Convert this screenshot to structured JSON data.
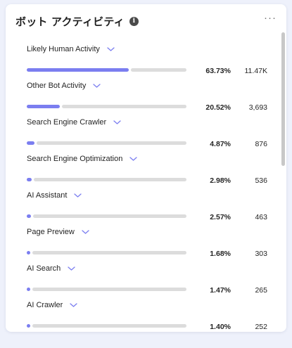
{
  "widget": {
    "title": "ボット アクティビティ",
    "info_icon_glyph": "i",
    "more_icon_glyph": "···",
    "accent_color": "#7b7ef0",
    "track_color": "#dcdcdc"
  },
  "chart_data": {
    "type": "bar",
    "orientation": "horizontal",
    "categories": [
      "Likely Human Activity",
      "Other Bot Activity",
      "Search Engine Crawler",
      "Search Engine Optimization",
      "AI Assistant",
      "Page Preview",
      "AI Search",
      "AI Crawler"
    ],
    "series": [
      {
        "values": [
          63.73,
          20.52,
          4.87,
          2.98,
          2.57,
          1.68,
          1.47,
          1.4
        ]
      }
    ],
    "xlim": [
      0,
      100
    ],
    "grid": false
  },
  "rows": [
    {
      "label": "Likely Human Activity",
      "percent": "63.73%",
      "count": "11.47K",
      "share": 63.73
    },
    {
      "label": "Other Bot Activity",
      "percent": "20.52%",
      "count": "3,693",
      "share": 20.52
    },
    {
      "label": "Search Engine Crawler",
      "percent": "4.87%",
      "count": "876",
      "share": 4.87
    },
    {
      "label": "Search Engine Optimization",
      "percent": "2.98%",
      "count": "536",
      "share": 2.98
    },
    {
      "label": "AI Assistant",
      "percent": "2.57%",
      "count": "463",
      "share": 2.57
    },
    {
      "label": "Page Preview",
      "percent": "1.68%",
      "count": "303",
      "share": 1.68
    },
    {
      "label": "AI Search",
      "percent": "1.47%",
      "count": "265",
      "share": 1.47
    },
    {
      "label": "AI Crawler",
      "percent": "1.40%",
      "count": "252",
      "share": 1.4
    }
  ]
}
